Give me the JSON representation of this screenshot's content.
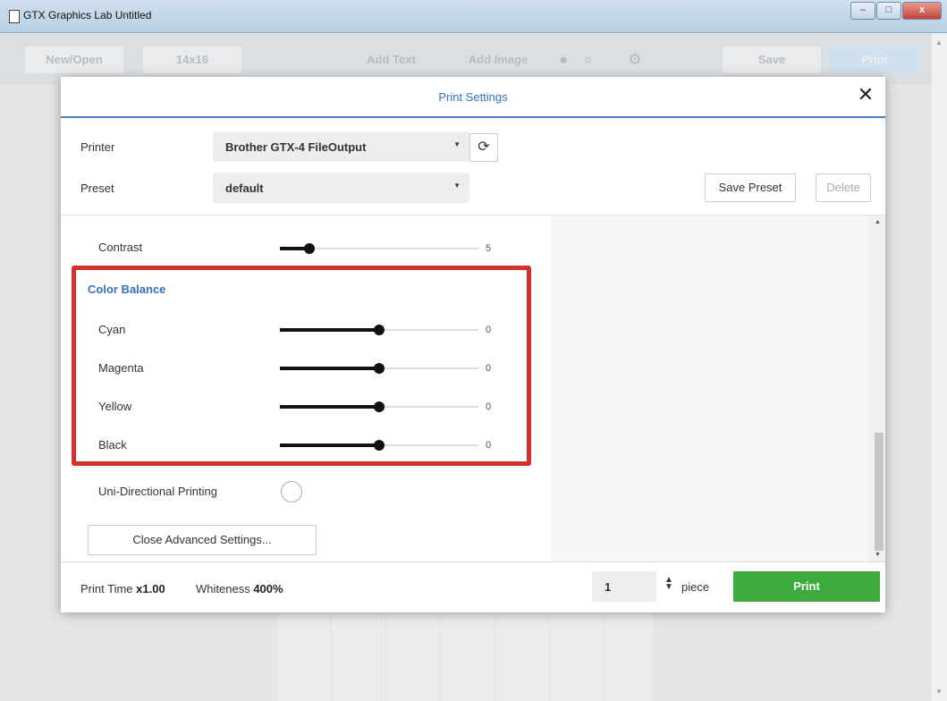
{
  "window": {
    "title": "GTX Graphics Lab Untitled",
    "min_glyph": "–",
    "max_glyph": "□",
    "close_glyph": "x"
  },
  "toolbar": {
    "new_open": "New/Open",
    "size": "14x16",
    "add_text": "Add Text",
    "add_image": "Add Image",
    "save": "Save",
    "print": "Print"
  },
  "dialog": {
    "title": "Print Settings",
    "close_glyph": "✕",
    "printer_label": "Printer",
    "printer_value": "Brother GTX-4 FileOutput",
    "preset_label": "Preset",
    "preset_value": "default",
    "save_preset": "Save Preset",
    "delete": "Delete",
    "caret": "▼",
    "refresh_glyph": "⟳"
  },
  "adjustments": {
    "contrast": {
      "label": "Contrast",
      "value": "5",
      "fraction": 0.15
    },
    "color_balance_title": "Color Balance",
    "channels": [
      {
        "label": "Cyan",
        "value": "0",
        "fraction": 0.5
      },
      {
        "label": "Magenta",
        "value": "0",
        "fraction": 0.5
      },
      {
        "label": "Yellow",
        "value": "0",
        "fraction": 0.5
      },
      {
        "label": "Black",
        "value": "0",
        "fraction": 0.5
      }
    ],
    "uni_directional_label": "Uni-Directional Printing",
    "close_advanced": "Close Advanced Settings..."
  },
  "footer": {
    "print_time_label": "Print Time",
    "print_time_value": "x1.00",
    "whiteness_label": "Whiteness",
    "whiteness_value": "400%",
    "quantity": "1",
    "spin_glyph": "▲▼",
    "unit": "piece",
    "print_button": "Print"
  },
  "colors": {
    "accent": "#3670b8",
    "highlight": "#d3322c",
    "print_green": "#3daa3d"
  }
}
